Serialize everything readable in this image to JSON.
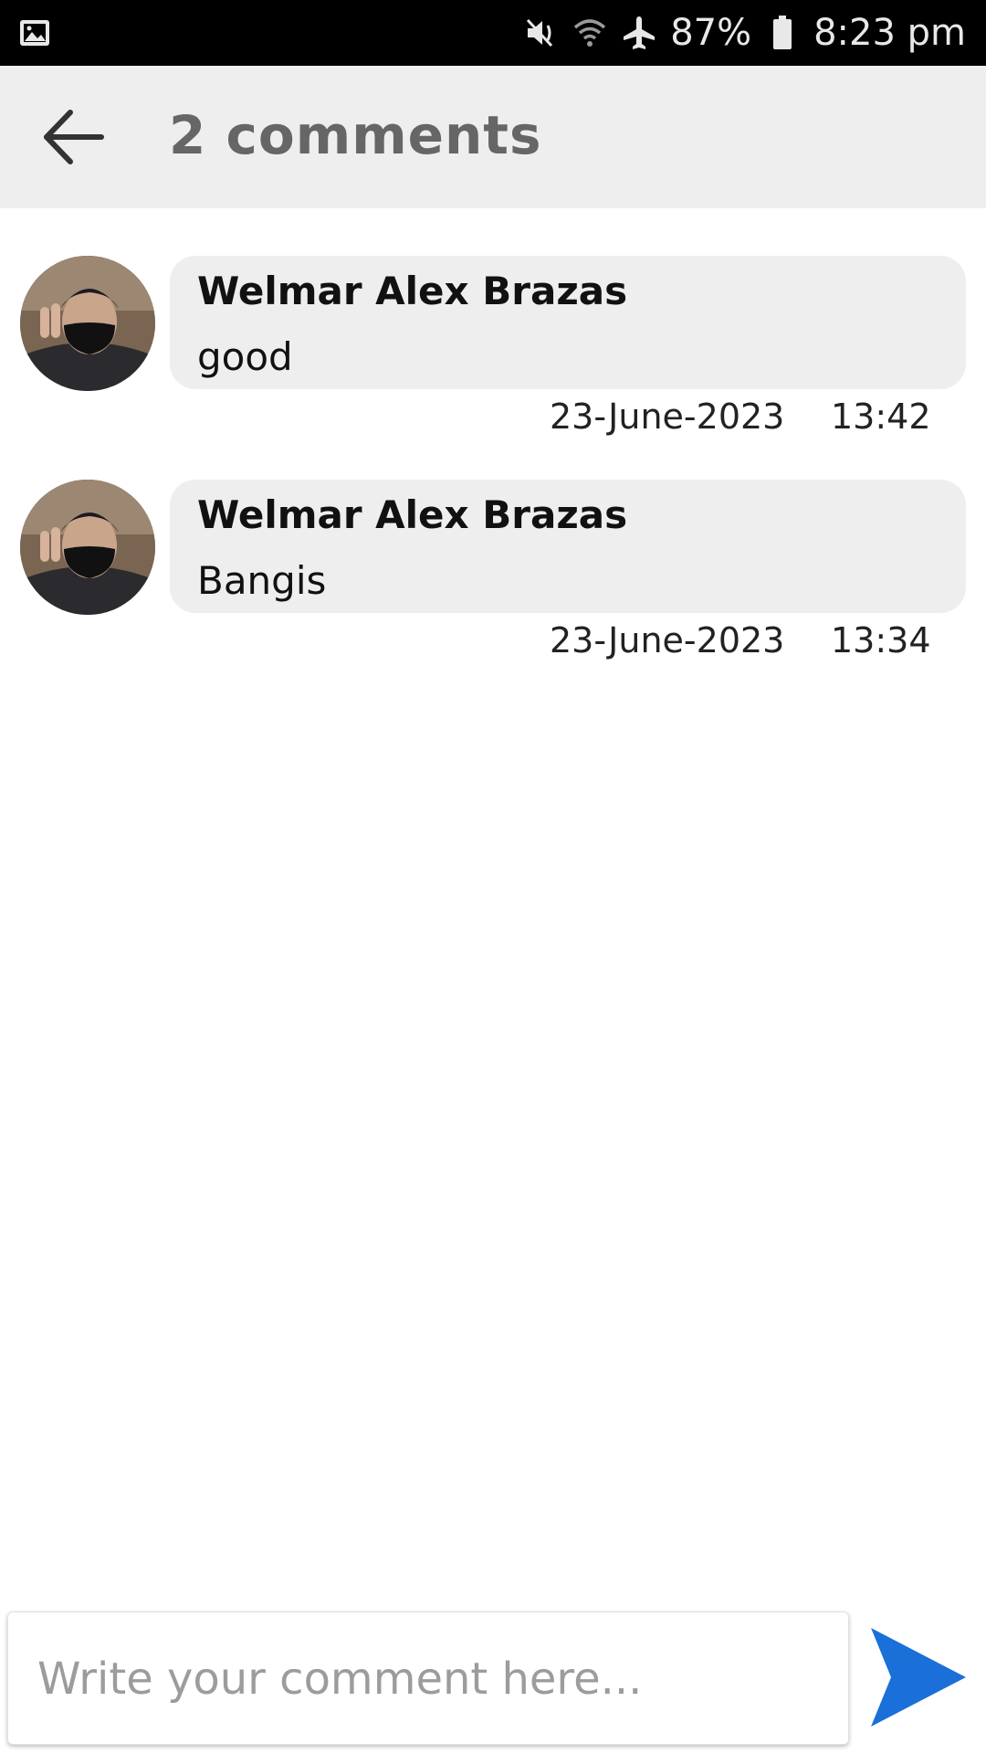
{
  "status_bar": {
    "icons": [
      "image-icon",
      "mute-icon",
      "wifi-icon",
      "airplane-icon",
      "battery-icon"
    ],
    "battery": "87%",
    "time": "8:23 pm"
  },
  "header": {
    "title": "2 comments",
    "back_icon": "arrow-left-icon"
  },
  "comments": [
    {
      "author": "Welmar Alex Brazas",
      "text": "good",
      "date": "23-June-2023",
      "time": "13:42"
    },
    {
      "author": "Welmar Alex Brazas",
      "text": "Bangis",
      "date": "23-June-2023",
      "time": "13:34"
    }
  ],
  "composer": {
    "placeholder": "Write your comment here...",
    "value": "",
    "send_icon": "send-icon",
    "send_color": "#1a73e8"
  },
  "colors": {
    "header_bg": "#eeeeee",
    "bubble_bg": "#eeeeee",
    "title": "#666666"
  }
}
